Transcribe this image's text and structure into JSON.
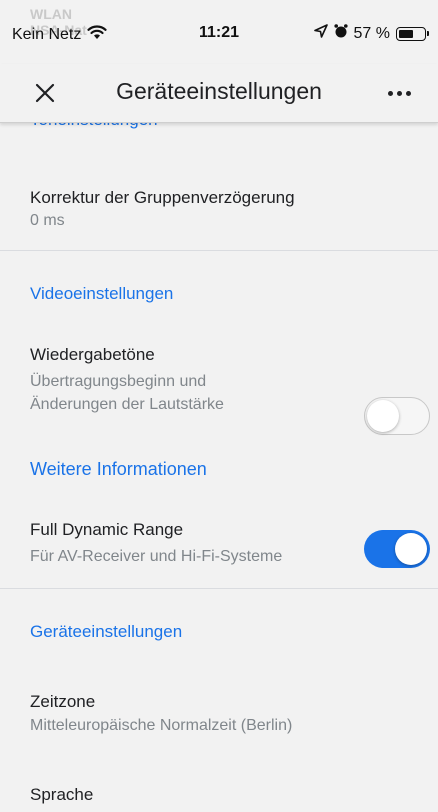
{
  "status_bar": {
    "ghost_text": "WLAN\nNSA-Nat",
    "carrier": "Kein Netz",
    "time": "11:21",
    "battery": "57 %"
  },
  "app_bar": {
    "title": "Geräteeinstellungen"
  },
  "sections": {
    "tone_header": "Toneinstellungen",
    "video_header": "Videoeinstellungen",
    "device_header": "Geräteeinstellungen"
  },
  "items": {
    "group_delay": {
      "title": "Korrektur der Gruppenverzögerung",
      "subtitle": "0 ms"
    },
    "playback_tones": {
      "title": "Wiedergabetöne",
      "subtitle_line1": "Übertragungsbeginn und",
      "subtitle_line2": "Änderungen der Lautstärke",
      "enabled": false
    },
    "more_info": "Weitere Informationen",
    "full_dynamic_range": {
      "title": "Full Dynamic Range",
      "subtitle": "Für AV-Receiver und Hi-Fi-Systeme",
      "enabled": true
    },
    "timezone": {
      "title": "Zeitzone",
      "subtitle": "Mitteleuropäische Normalzeit (Berlin)"
    },
    "language": {
      "title": "Sprache"
    }
  },
  "colors": {
    "accent": "#1a73e8",
    "background": "#f2f2f2",
    "secondary_text": "#80868b"
  }
}
